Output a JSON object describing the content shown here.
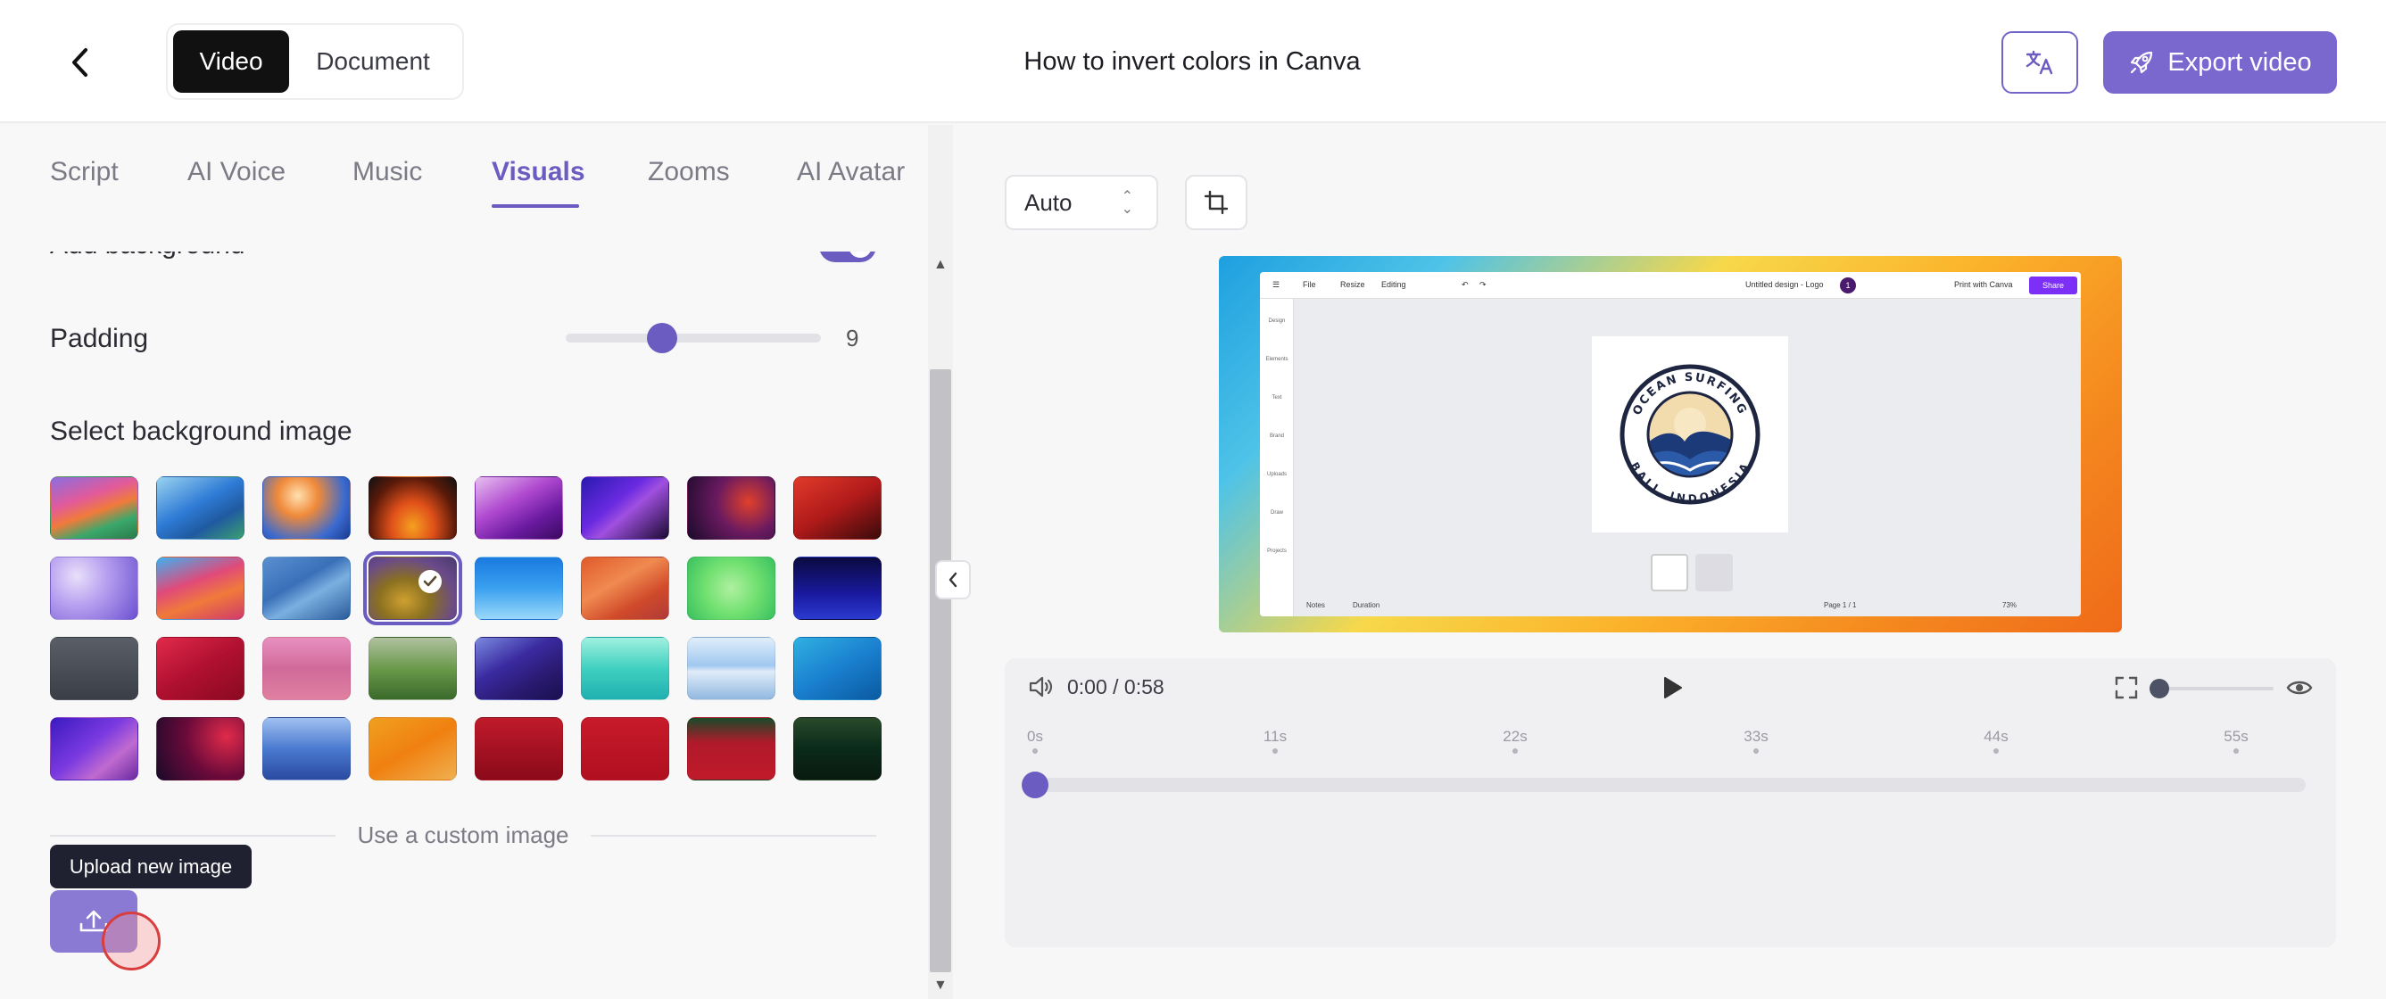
{
  "header": {
    "mode_video": "Video",
    "mode_document": "Document",
    "title": "How to invert colors in Canva",
    "export_label": "Export video"
  },
  "tabs": [
    {
      "label": "Script"
    },
    {
      "label": "AI Voice"
    },
    {
      "label": "Music"
    },
    {
      "label": "Visuals",
      "active": true
    },
    {
      "label": "Zooms"
    },
    {
      "label": "AI Avatar"
    }
  ],
  "visuals": {
    "add_background_label": "Add background",
    "add_background_on": true,
    "padding_label": "Padding",
    "padding_value": "9",
    "select_bg_label": "Select background image",
    "custom_image_label": "Use a custom image",
    "upload_tooltip": "Upload new image",
    "selected_index": 11
  },
  "toolbar": {
    "aspect_value": "Auto"
  },
  "player": {
    "time": "0:00 / 0:58",
    "ticks": [
      "0s",
      "11s",
      "22s",
      "33s",
      "44s",
      "55s"
    ],
    "progress": 0
  },
  "canva_preview": {
    "file": "File",
    "resize": "Resize",
    "editing": "Editing",
    "doc_title": "Untitled design - Logo",
    "avatar": "1",
    "print": "Print with Canva",
    "share": "Share",
    "side_items": [
      "Design",
      "Elements",
      "Text",
      "Brand",
      "Uploads",
      "Draw",
      "Projects"
    ],
    "logo_top": "OCEAN SURFING",
    "logo_bottom": "BALI, INDONESIA",
    "notes": "Notes",
    "duration": "Duration",
    "page": "Page 1 / 1",
    "zoom": "73%"
  },
  "colors": {
    "accent": "#6a5cc0",
    "export_bg": "#7a68cf"
  }
}
